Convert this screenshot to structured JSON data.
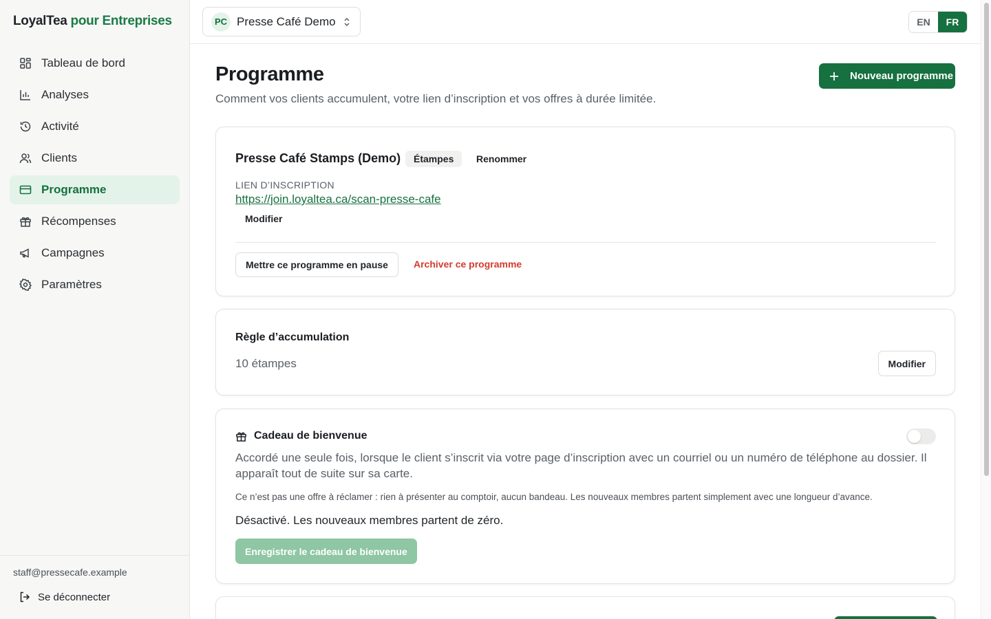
{
  "brand": {
    "name": "LoyalTea",
    "suffix": "pour Entreprises"
  },
  "sidebar": {
    "items": [
      {
        "label": "Tableau de bord",
        "icon": "dashboard-icon"
      },
      {
        "label": "Analyses",
        "icon": "bar-chart-icon"
      },
      {
        "label": "Activité",
        "icon": "history-icon"
      },
      {
        "label": "Clients",
        "icon": "users-icon"
      },
      {
        "label": "Programme",
        "icon": "card-icon",
        "active": true
      },
      {
        "label": "Récompenses",
        "icon": "gift-icon"
      },
      {
        "label": "Campagnes",
        "icon": "megaphone-icon"
      },
      {
        "label": "Paramètres",
        "icon": "gear-icon"
      }
    ],
    "user_email": "staff@pressecafe.example",
    "logout_label": "Se déconnecter"
  },
  "topbar": {
    "org_initials": "PC",
    "org_name": "Presse Café Demo",
    "lang_en": "EN",
    "lang_fr": "FR",
    "lang_active": "FR"
  },
  "page": {
    "title": "Programme",
    "subtitle": "Comment vos clients accumulent, votre lien d’inscription et vos offres à durée limitée.",
    "new_program_label": "Nouveau programme"
  },
  "program": {
    "name": "Presse Café Stamps (Demo)",
    "type_badge": "Étampes",
    "rename_label": "Renommer",
    "signup_label": "LIEN D’INSCRIPTION",
    "signup_url": "https://join.loyaltea.ca/scan-presse-cafe",
    "edit_link_label": "Modifier",
    "pause_label": "Mettre ce programme en pause",
    "archive_label": "Archiver ce programme"
  },
  "accumulation": {
    "title": "Règle d’accumulation",
    "value": "10 étampes",
    "edit_label": "Modifier"
  },
  "welcome_gift": {
    "title": "Cadeau de bienvenue",
    "enabled": false,
    "description": "Accordé une seule fois, lorsque le client s’inscrit via votre page d’inscription avec un courriel ou un numéro de téléphone au dossier. Il apparaît tout de suite sur sa carte.",
    "note": "Ce n’est pas une offre à réclamer : rien à présenter au comptoir, aucun bandeau. Les nouveaux membres partent simplement avec une longueur d’avance.",
    "status": "Désactivé. Les nouveaux membres partent de zéro.",
    "save_label": "Enregistrer le cadeau de bienvenue"
  },
  "colors": {
    "accent": "#16703f",
    "accent_light": "#e4f3e9",
    "danger": "#d33a2c",
    "disabled_accent": "#8fc6a3"
  }
}
